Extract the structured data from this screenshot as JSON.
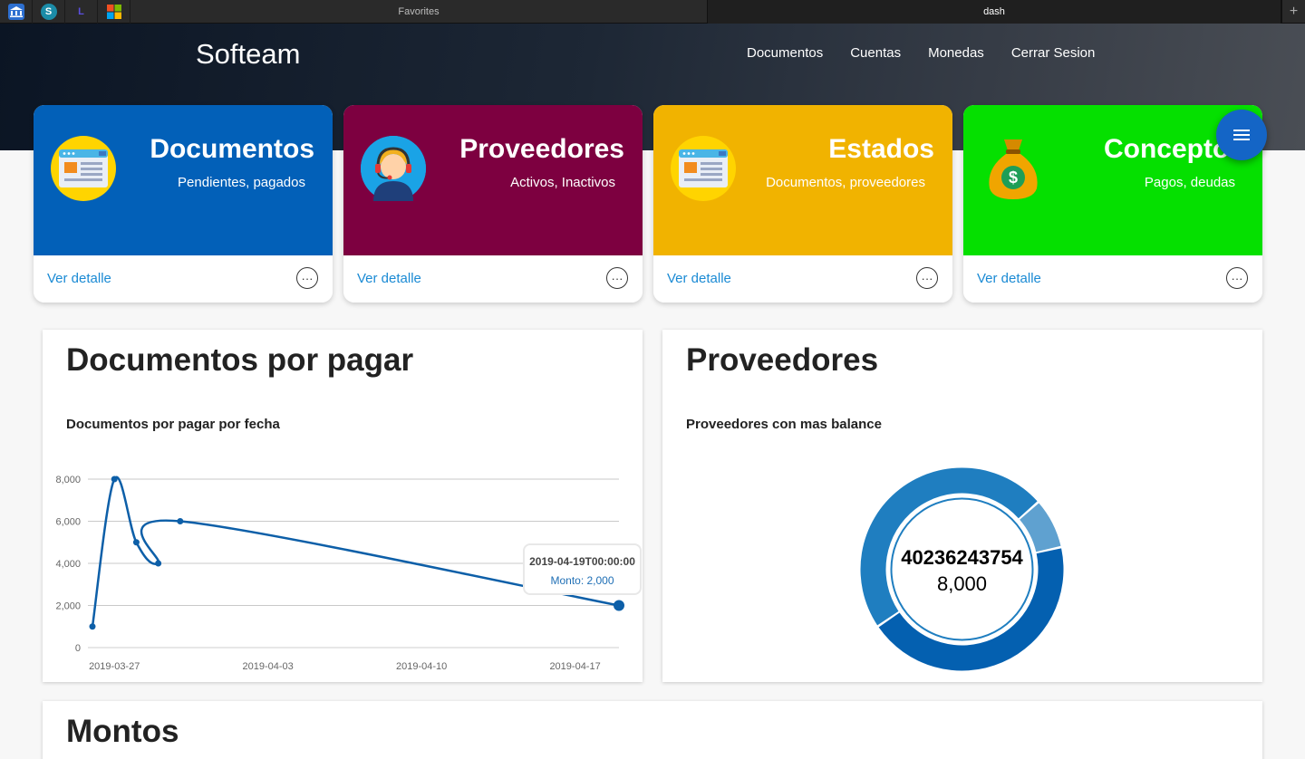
{
  "browser": {
    "tabs": [
      {
        "label": "Favorites"
      },
      {
        "label": "dash"
      }
    ],
    "new_tab": "+"
  },
  "header": {
    "brand": "Softeam",
    "nav": [
      "Documentos",
      "Cuentas",
      "Monedas",
      "Cerrar Sesion"
    ]
  },
  "cards": [
    {
      "title": "Documentos",
      "subtitle": "Pendientes, pagados",
      "link": "Ver detalle",
      "color": "#0260b8",
      "icon": "document-icon"
    },
    {
      "title": "Proveedores",
      "subtitle": "Activos, Inactivos",
      "link": "Ver detalle",
      "color": "#7d0040",
      "icon": "support-agent-icon"
    },
    {
      "title": "Estados",
      "subtitle": "Documentos, proveedores",
      "link": "Ver detalle",
      "color": "#f1b300",
      "icon": "document-icon"
    },
    {
      "title": "Conceptos",
      "subtitle": "Pagos, deudas",
      "link": "Ver detalle",
      "color": "#05e000",
      "icon": "money-bag-icon"
    }
  ],
  "more_glyph": "···",
  "panels": {
    "documentos": {
      "title": "Documentos por pagar",
      "subtitle": "Documentos por pagar por fecha"
    },
    "proveedores": {
      "title": "Proveedores",
      "subtitle": "Proveedores con mas balance"
    },
    "montos": {
      "title": "Montos"
    }
  },
  "chart_data": [
    {
      "type": "line",
      "title": "Documentos por pagar por fecha",
      "x": [
        "2019-03-26",
        "2019-03-27",
        "2019-03-28",
        "2019-03-29",
        "2019-03-30",
        "2019-04-19"
      ],
      "x_note": "",
      "values": [
        1000,
        8000,
        5000,
        4000,
        6000,
        2000
      ],
      "xlim": [
        "2019-03-26",
        "2019-04-19"
      ],
      "ylim": [
        0,
        8000
      ],
      "yticks": [
        "0",
        "2,000",
        "4,000",
        "6,000",
        "8,000"
      ],
      "xticks": [
        "2019-03-27",
        "2019-04-03",
        "2019-04-10",
        "2019-04-17"
      ],
      "grid": true,
      "color": "#0d5fa8",
      "tooltip": {
        "label": "2019-04-19T00:00:00",
        "value": "Monto: 2,000"
      }
    },
    {
      "type": "pie",
      "title": "Proveedores con mas balance",
      "slices": [
        {
          "value": 48,
          "color": "#1f7ec0"
        },
        {
          "value": 8,
          "color": "#5fa1d0"
        },
        {
          "value": 44,
          "color": "#0460b0"
        }
      ],
      "center_label": "40236243754",
      "center_value": "8,000"
    }
  ]
}
